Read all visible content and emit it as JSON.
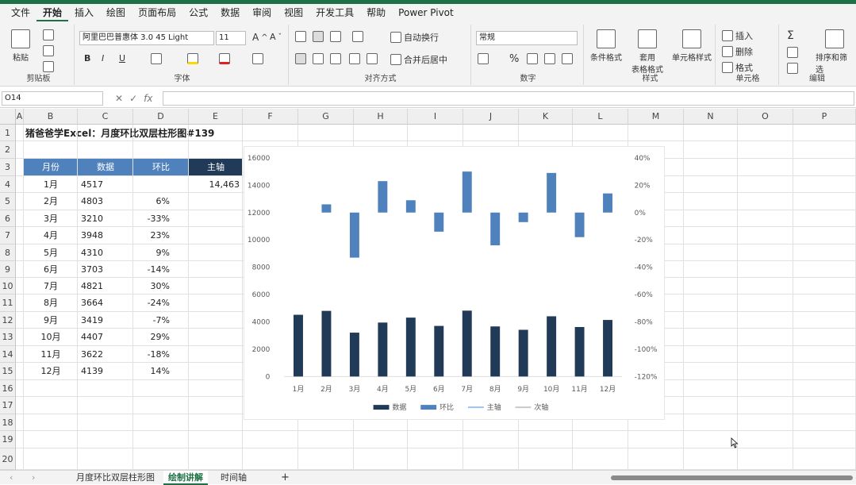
{
  "menu": [
    "文件",
    "开始",
    "插入",
    "绘图",
    "页面布局",
    "公式",
    "数据",
    "审阅",
    "视图",
    "开发工具",
    "帮助",
    "Power Pivot"
  ],
  "ribbon": {
    "clipboard": {
      "label": "剪贴板",
      "paste": "粘贴"
    },
    "font": {
      "label": "字体",
      "name": "阿里巴巴普惠体 3.0 45 Light",
      "size": "11",
      "bold": "B",
      "italic": "I",
      "underline": "U"
    },
    "align": {
      "label": "对齐方式",
      "wrap": "自动换行",
      "merge": "合并后居中"
    },
    "number": {
      "label": "数字",
      "format": "常规",
      "percent": "%"
    },
    "styles": {
      "label": "样式",
      "cond": "条件格式",
      "table": "套用\n表格格式",
      "cell": "单元格样式"
    },
    "cells": {
      "label": "单元格",
      "insert": "插入",
      "delete": "删除",
      "format": "格式"
    },
    "edit": {
      "label": "编辑",
      "sort": "排序和筛选"
    }
  },
  "formula": {
    "namebox": "O14",
    "fx": "fx",
    "value": ""
  },
  "columns": [
    "A",
    "B",
    "C",
    "D",
    "E",
    "F",
    "G",
    "H",
    "I",
    "J",
    "K",
    "L",
    "M",
    "N",
    "O",
    "P"
  ],
  "rows": [
    "1",
    "2",
    "3",
    "4",
    "5",
    "6",
    "7",
    "8",
    "9",
    "10",
    "11",
    "12",
    "13",
    "14",
    "15",
    "16",
    "17",
    "18",
    "19",
    "20"
  ],
  "sheet": {
    "title": "猪爸爸学Excel：月度环比双层柱形图#139",
    "headers": [
      "月份",
      "数据",
      "环比",
      "主轴"
    ],
    "data": [
      {
        "month": "1月",
        "value": "4517",
        "ratio": ""
      },
      {
        "month": "2月",
        "value": "4803",
        "ratio": "6%"
      },
      {
        "month": "3月",
        "value": "3210",
        "ratio": "-33%"
      },
      {
        "month": "4月",
        "value": "3948",
        "ratio": "23%"
      },
      {
        "month": "5月",
        "value": "4310",
        "ratio": "9%"
      },
      {
        "month": "6月",
        "value": "3703",
        "ratio": "-14%"
      },
      {
        "month": "7月",
        "value": "4821",
        "ratio": "30%"
      },
      {
        "month": "8月",
        "value": "3664",
        "ratio": "-24%"
      },
      {
        "month": "9月",
        "value": "3419",
        "ratio": "-7%"
      },
      {
        "month": "10月",
        "value": "4407",
        "ratio": "29%"
      },
      {
        "month": "11月",
        "value": "3622",
        "ratio": "-18%"
      },
      {
        "month": "12月",
        "value": "4139",
        "ratio": "14%"
      }
    ],
    "axis_value": "14,463"
  },
  "chart_data": {
    "type": "bar",
    "categories": [
      "1月",
      "2月",
      "3月",
      "4月",
      "5月",
      "6月",
      "7月",
      "8月",
      "9月",
      "10月",
      "11月",
      "12月"
    ],
    "series": [
      {
        "name": "数据",
        "values": [
          4517,
          4803,
          3210,
          3948,
          4310,
          3703,
          4821,
          3664,
          3419,
          4407,
          3622,
          4139
        ],
        "color": "#203a57",
        "axis": "primary"
      },
      {
        "name": "环比",
        "values": [
          null,
          0.06,
          -0.33,
          0.23,
          0.09,
          -0.14,
          0.3,
          -0.24,
          -0.07,
          0.29,
          -0.18,
          0.14
        ],
        "color": "#4f81bd",
        "axis": "secondary"
      },
      {
        "name": "主轴",
        "color": "#9dc3e6",
        "type": "line"
      },
      {
        "name": "次轴",
        "color": "#c9c9c9",
        "type": "line"
      }
    ],
    "y_ticks": [
      "0",
      "2000",
      "4000",
      "6000",
      "8000",
      "10000",
      "12000",
      "14000",
      "16000"
    ],
    "ylim": [
      0,
      16000
    ],
    "y2_ticks": [
      "-120%",
      "-100%",
      "-80%",
      "-60%",
      "-40%",
      "-20%",
      "0%",
      "20%",
      "40%"
    ],
    "y2lim": [
      -1.2,
      0.4
    ],
    "legend": "bottom"
  },
  "tabs": [
    "月度环比双层柱形图",
    "绘制讲解",
    "时间轴"
  ],
  "tab_add": "+"
}
